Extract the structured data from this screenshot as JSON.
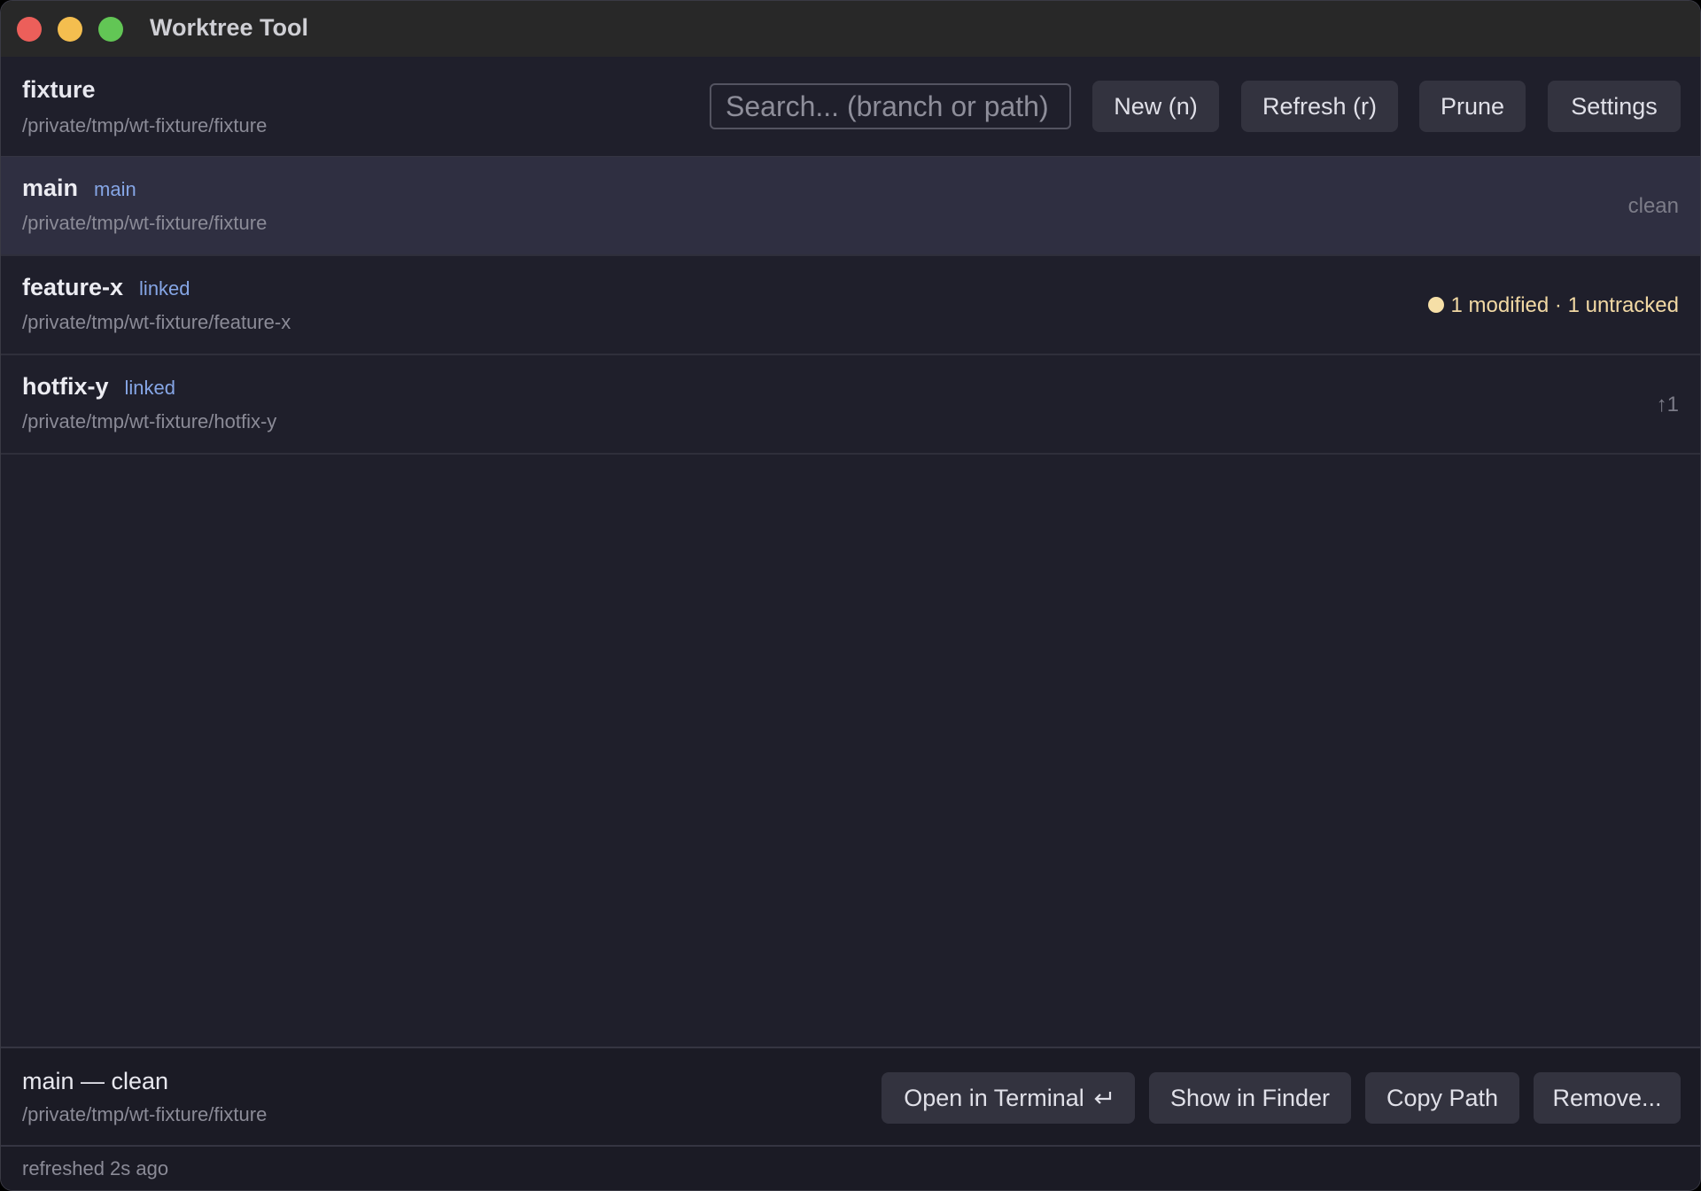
{
  "window": {
    "title": "Worktree Tool"
  },
  "header": {
    "repo_name": "fixture",
    "repo_path": "/private/tmp/wt-fixture/fixture",
    "search_placeholder": "Search... (branch or path)",
    "buttons": {
      "new": "New (n)",
      "refresh": "Refresh (r)",
      "prune": "Prune",
      "settings": "Settings"
    }
  },
  "worktrees": [
    {
      "branch": "main",
      "kind": "main",
      "path": "/private/tmp/wt-fixture/fixture",
      "status": "clean",
      "selected": true
    },
    {
      "branch": "feature-x",
      "kind": "linked",
      "path": "/private/tmp/wt-fixture/feature-x",
      "status": "1 modified · 1 untracked",
      "status_color": "#f2d9a4"
    },
    {
      "branch": "hotfix-y",
      "kind": "linked",
      "path": "/private/tmp/wt-fixture/hotfix-y",
      "status": "↑1"
    }
  ],
  "detail": {
    "title": "main — clean",
    "path": "/private/tmp/wt-fixture/fixture",
    "buttons": {
      "open_terminal": "Open in Terminal",
      "show_finder": "Show in Finder",
      "copy_path": "Copy Path",
      "remove": "Remove..."
    }
  },
  "statusbar": {
    "text": "refreshed 2s ago"
  },
  "colors": {
    "background": "#1f1f2b",
    "selected_row": "#2f2f41",
    "kind_label": "#86a6e6",
    "dirty_dot": "#f6dfa7"
  }
}
